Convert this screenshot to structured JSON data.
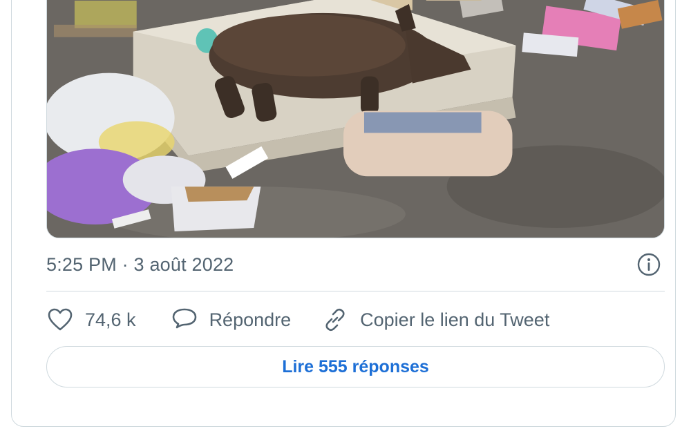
{
  "tweet": {
    "media": {
      "icon": "photo-boar-on-mattress"
    },
    "timestamp": "5:25 PM · 3 août 2022",
    "info_icon": "info-circle-icon",
    "actions": {
      "like": {
        "icon": "heart-icon",
        "count": "74,6 k"
      },
      "reply": {
        "icon": "speech-bubble-icon",
        "label": "Répondre"
      },
      "copy_link": {
        "icon": "link-icon",
        "label": "Copier le lien du Tweet"
      }
    },
    "read_replies_label": "Lire 555 réponses"
  },
  "colors": {
    "muted_text": "#536471",
    "border": "#cfd9de",
    "link_blue": "#1d6fd6"
  }
}
